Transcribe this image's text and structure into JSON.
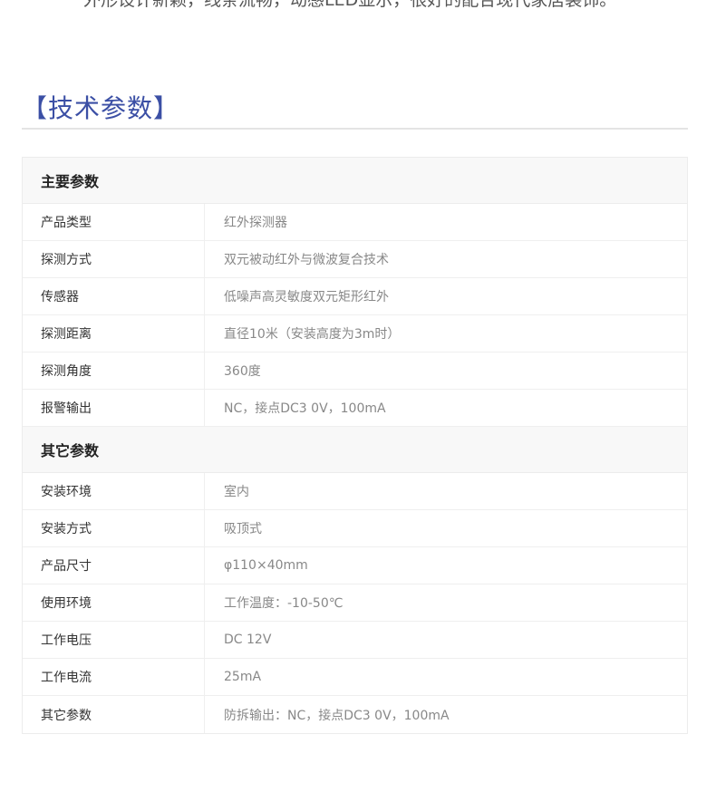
{
  "intro": {
    "text": "外形设计新颖，线条流畅，动感LED显示，很好的配合现代家居装饰。"
  },
  "section": {
    "title": "【技术参数】"
  },
  "groups": [
    {
      "title": "主要参数",
      "rows": [
        {
          "label": "产品类型",
          "value": "红外探测器"
        },
        {
          "label": "探测方式",
          "value": "双元被动红外与微波复合技术"
        },
        {
          "label": "传感器",
          "value": "低噪声高灵敏度双元矩形红外"
        },
        {
          "label": "探测距离",
          "value": "直径10米（安装高度为3m时）"
        },
        {
          "label": "探测角度",
          "value": "360度"
        },
        {
          "label": "报警输出",
          "value": "NC，接点DC3 0V，100mA"
        }
      ]
    },
    {
      "title": "其它参数",
      "rows": [
        {
          "label": "安装环境",
          "value": "室内"
        },
        {
          "label": "安装方式",
          "value": "吸顶式"
        },
        {
          "label": "产品尺寸",
          "value": "φ110×40mm"
        },
        {
          "label": "使用环境",
          "value": "工作温度：-10-50℃"
        },
        {
          "label": "工作电压",
          "value": "DC 12V"
        },
        {
          "label": "工作电流",
          "value": "25mA"
        },
        {
          "label": "其它参数",
          "value": "防拆输出：NC，接点DC3 0V，100mA"
        }
      ]
    }
  ]
}
